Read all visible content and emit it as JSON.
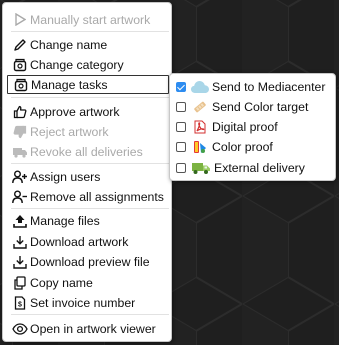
{
  "context_menu": {
    "items": [
      {
        "label": "Manually start artwork",
        "icon": "play-icon",
        "disabled": true
      },
      {
        "label": "Change name",
        "icon": "pencil-icon",
        "disabled": false
      },
      {
        "label": "Change category",
        "icon": "category-icon",
        "disabled": false
      },
      {
        "label": "Manage tasks",
        "icon": "tasks-icon",
        "disabled": false,
        "active": true
      },
      {
        "label": "Approve artwork",
        "icon": "thumbs-up-icon",
        "disabled": false
      },
      {
        "label": "Reject artwork",
        "icon": "thumbs-down-icon",
        "disabled": true
      },
      {
        "label": "Revoke all deliveries",
        "icon": "revoke-deliveries-icon",
        "disabled": true
      },
      {
        "label": "Assign users",
        "icon": "user-plus-icon",
        "disabled": false
      },
      {
        "label": "Remove all assignments",
        "icon": "user-minus-icon",
        "disabled": false
      },
      {
        "label": "Manage files",
        "icon": "upload-icon",
        "disabled": false
      },
      {
        "label": "Download artwork",
        "icon": "download-icon",
        "disabled": false
      },
      {
        "label": "Download preview file",
        "icon": "download-preview-icon",
        "disabled": false
      },
      {
        "label": "Copy name",
        "icon": "copy-icon",
        "disabled": false
      },
      {
        "label": "Set invoice number",
        "icon": "invoice-icon",
        "disabled": false
      },
      {
        "label": "Open in artwork viewer",
        "icon": "eye-icon",
        "disabled": false
      }
    ]
  },
  "tasks_submenu": {
    "items": [
      {
        "label": "Send to Mediacenter",
        "icon": "cloud-icon",
        "checked": true
      },
      {
        "label": "Send Color target",
        "icon": "color-target-icon",
        "checked": false
      },
      {
        "label": "Digital proof",
        "icon": "pdf-icon",
        "checked": false
      },
      {
        "label": "Color proof",
        "icon": "color-proof-icon",
        "checked": false
      },
      {
        "label": "External delivery",
        "icon": "truck-icon",
        "checked": false
      }
    ]
  },
  "colors": {
    "background": "#1e1e1e",
    "checkbox_checked": "#2d8cf0",
    "disabled_text": "#a9a9a9"
  }
}
